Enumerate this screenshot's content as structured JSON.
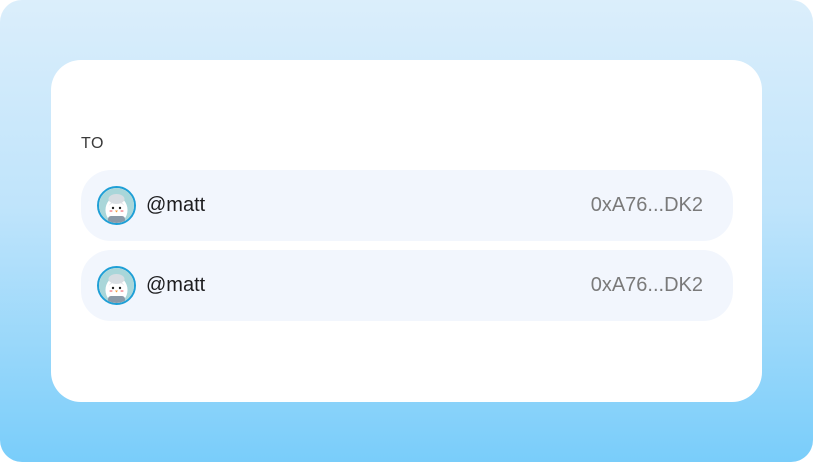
{
  "send_form": {
    "to_label": "TO",
    "recipients": [
      {
        "handle": "@matt",
        "address": "0xA76...DK2",
        "avatar_icon": "penguin-avatar-icon"
      },
      {
        "handle": "@matt",
        "address": "0xA76...DK2",
        "avatar_icon": "penguin-avatar-icon"
      }
    ]
  },
  "colors": {
    "background_top": "#dbeefb",
    "background_bottom": "#79cdfa",
    "card": "#ffffff",
    "row": "#f2f6fd",
    "avatar_ring": "#1e9fd6",
    "handle_text": "#1d1d1f",
    "address_text": "#7a7a7a"
  }
}
